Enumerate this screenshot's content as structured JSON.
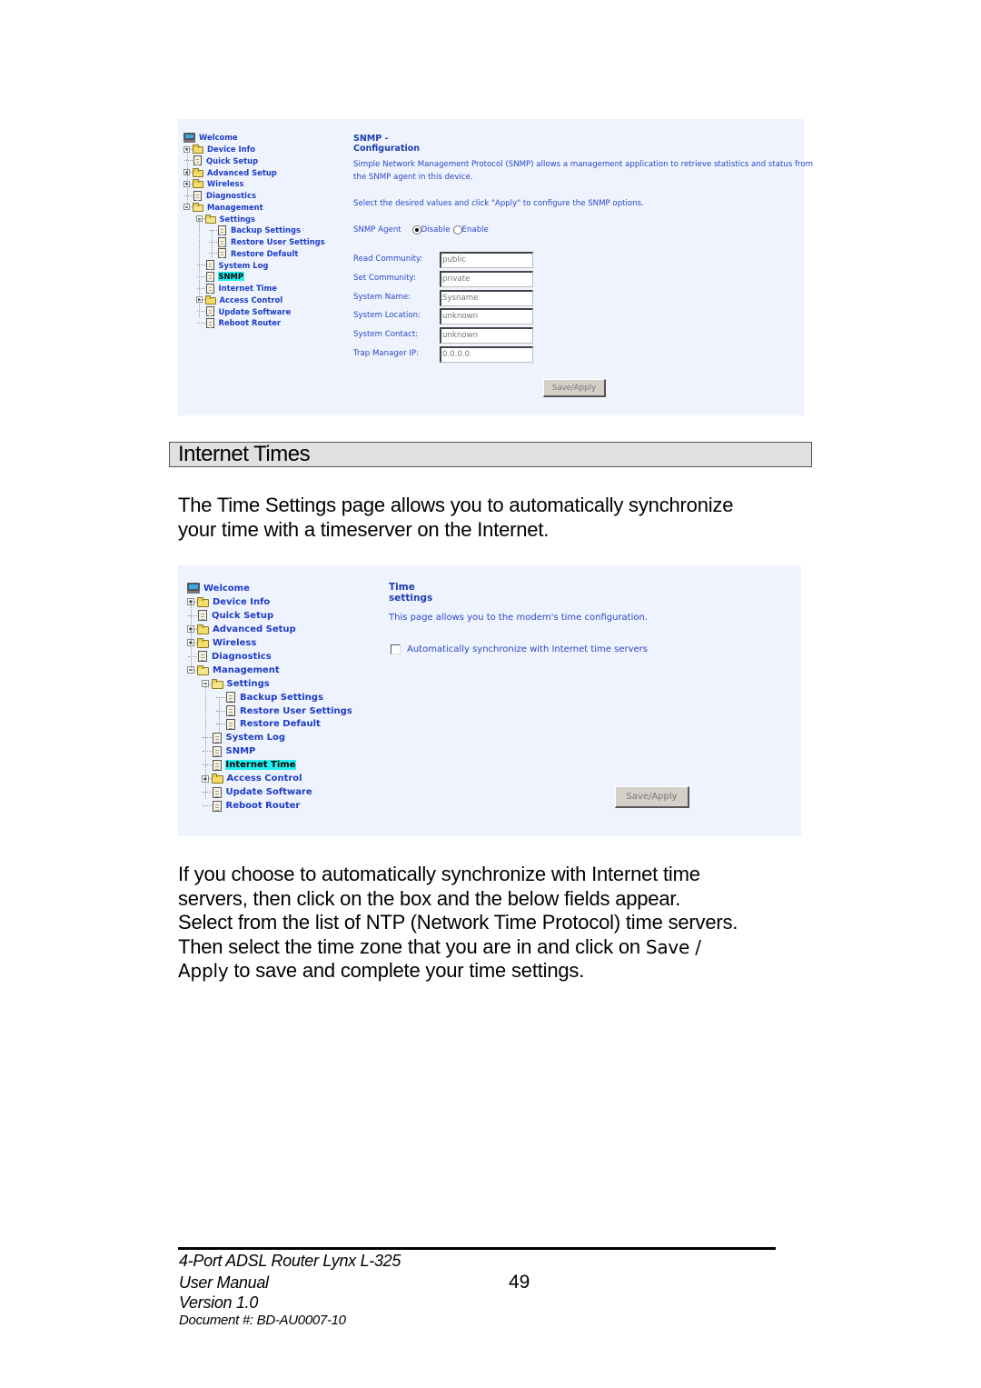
{
  "snmp_screenshot": {
    "tree": [
      {
        "label": "Welcome",
        "icon": "monitor-icon",
        "level": 0
      },
      {
        "label": "Device Info",
        "icon": "folder-icon",
        "expander": "plus",
        "level": 1
      },
      {
        "label": "Quick Setup",
        "icon": "document-icon",
        "level": 1
      },
      {
        "label": "Advanced Setup",
        "icon": "folder-icon",
        "expander": "plus",
        "level": 1
      },
      {
        "label": "Wireless",
        "icon": "folder-icon",
        "expander": "plus",
        "level": 1
      },
      {
        "label": "Diagnostics",
        "icon": "document-icon",
        "level": 1
      },
      {
        "label": "Management",
        "icon": "folder-open-icon",
        "expander": "minus",
        "level": 1
      },
      {
        "label": "Settings",
        "icon": "folder-open-icon",
        "expander": "minus",
        "level": 2
      },
      {
        "label": "Backup Settings",
        "icon": "document-icon",
        "level": 3
      },
      {
        "label": "Restore User Settings",
        "icon": "document-icon",
        "level": 3
      },
      {
        "label": "Restore Default",
        "icon": "document-icon",
        "level": 3
      },
      {
        "label": "System Log",
        "icon": "document-icon",
        "level": 2
      },
      {
        "label": "SNMP",
        "icon": "document-icon",
        "level": 2,
        "selected": true
      },
      {
        "label": "Internet Time",
        "icon": "document-icon",
        "level": 2
      },
      {
        "label": "Access Control",
        "icon": "folder-icon",
        "expander": "plus",
        "level": 2
      },
      {
        "label": "Update Software",
        "icon": "document-icon",
        "level": 2
      },
      {
        "label": "Reboot Router",
        "icon": "document-icon",
        "level": 2
      }
    ],
    "title": "SNMP - Configuration",
    "description_line1": "Simple Network Management Protocol (SNMP) allows a management application to retrieve statistics and status from",
    "description_line2": "the SNMP agent in this device.",
    "instruction": "Select the desired values and click \"Apply\" to configure the SNMP options.",
    "agent_label": "SNMP Agent",
    "agent_options": [
      {
        "label": "Disable",
        "selected": true
      },
      {
        "label": "Enable",
        "selected": false
      }
    ],
    "fields": [
      {
        "label": "Read Community:",
        "value": "public"
      },
      {
        "label": "Set Community:",
        "value": "private"
      },
      {
        "label": "System Name:",
        "value": "Sysname"
      },
      {
        "label": "System Location:",
        "value": "unknown"
      },
      {
        "label": "System Contact:",
        "value": "unknown"
      },
      {
        "label": "Trap Manager IP:",
        "value": "0.0.0.0"
      }
    ],
    "save_button": "Save/Apply"
  },
  "section_heading": "Internet Times",
  "intro_paragraph": [
    "The Time Settings page allows you to automatically synchronize",
    "your time with a timeserver on the Internet."
  ],
  "time_screenshot": {
    "tree": [
      {
        "label": "Welcome",
        "icon": "monitor-icon",
        "level": 0
      },
      {
        "label": "Device Info",
        "icon": "folder-icon",
        "expander": "plus",
        "level": 1
      },
      {
        "label": "Quick Setup",
        "icon": "document-icon",
        "level": 1
      },
      {
        "label": "Advanced Setup",
        "icon": "folder-icon",
        "expander": "plus",
        "level": 1
      },
      {
        "label": "Wireless",
        "icon": "folder-icon",
        "expander": "plus",
        "level": 1
      },
      {
        "label": "Diagnostics",
        "icon": "document-icon",
        "level": 1
      },
      {
        "label": "Management",
        "icon": "folder-open-icon",
        "expander": "minus",
        "level": 1
      },
      {
        "label": "Settings",
        "icon": "folder-open-icon",
        "expander": "minus",
        "level": 2
      },
      {
        "label": "Backup Settings",
        "icon": "document-icon",
        "level": 3
      },
      {
        "label": "Restore User Settings",
        "icon": "document-icon",
        "level": 3
      },
      {
        "label": "Restore Default",
        "icon": "document-icon",
        "level": 3
      },
      {
        "label": "System Log",
        "icon": "document-icon",
        "level": 2
      },
      {
        "label": "SNMP",
        "icon": "document-icon",
        "level": 2
      },
      {
        "label": "Internet Time",
        "icon": "document-icon",
        "level": 2,
        "selected": true
      },
      {
        "label": "Access Control",
        "icon": "folder-icon",
        "expander": "plus",
        "level": 2
      },
      {
        "label": "Update Software",
        "icon": "document-icon",
        "level": 2
      },
      {
        "label": "Reboot Router",
        "icon": "document-icon",
        "level": 2
      }
    ],
    "title": "Time settings",
    "description": "This page allows you to the modem's time configuration.",
    "auto_sync_label": "Automatically synchronize with Internet time servers",
    "auto_sync_checked": false,
    "save_button": "Save/Apply"
  },
  "body_paragraph": {
    "line1": "If you choose to automatically synchronize with Internet time",
    "line2": "servers, then click on the box and the below fields appear.",
    "line3": "Select from the list of NTP (Network Time Protocol) time servers.",
    "line4_pre": "Then select the time zone that you are in and click on ",
    "line4_bold": "Save /",
    "line5_bold": "Apply",
    "line5_post": " to save and complete your time settings."
  },
  "footer": {
    "product": "4-Port ADSL Router Lynx L-325",
    "manual": "User Manual",
    "version": "Version 1.0",
    "document": "Document #:  BD-AU0007-10",
    "page_number": "49"
  }
}
